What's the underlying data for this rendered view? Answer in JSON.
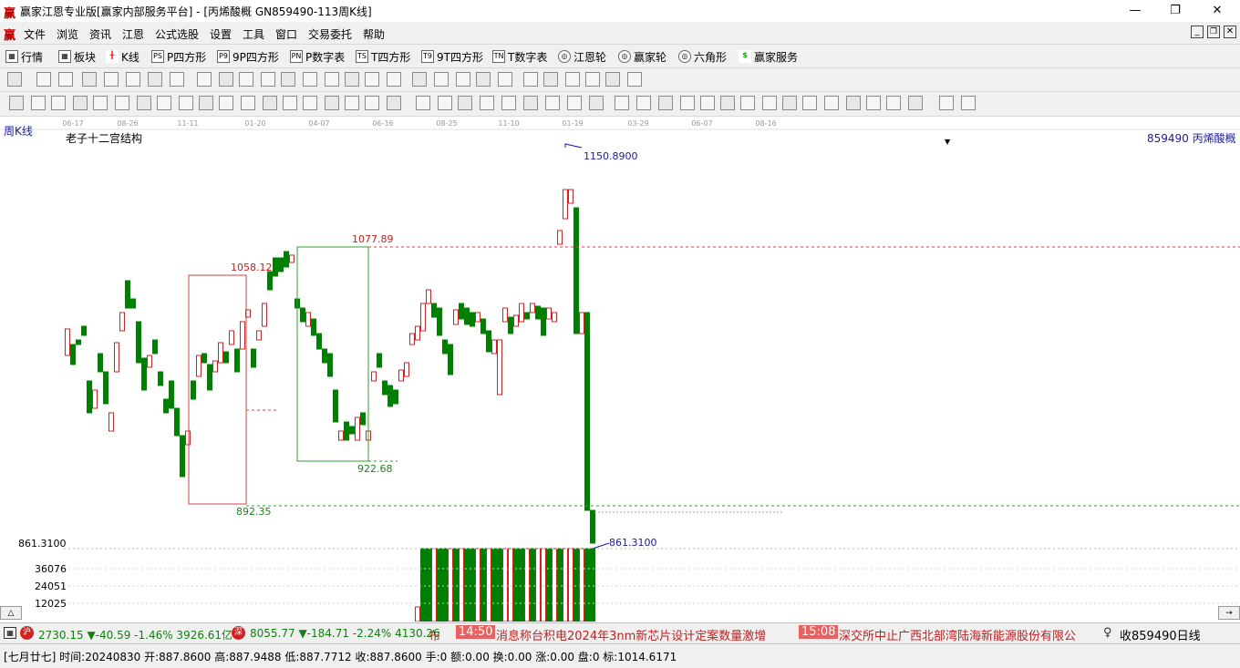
{
  "window": {
    "title": "赢家江恩专业版[赢家内部服务平台] - [丙烯酸概  GN859490-113周K线]"
  },
  "menu": [
    "文件",
    "浏览",
    "资讯",
    "江恩",
    "公式选股",
    "设置",
    "工具",
    "窗口",
    "交易委托",
    "帮助"
  ],
  "toolbar1": [
    "行情",
    "板块",
    "K线",
    "P四方形",
    "9P四方形",
    "P数字表",
    "T四方形",
    "9T四方形",
    "T数字表",
    "江恩轮",
    "赢家轮",
    "六角形",
    "赢家服务"
  ],
  "chart": {
    "period_label": "周K线",
    "indicator_title": "老子十二宫结构",
    "stock_label": "859490  丙烯酸概",
    "date_ticks": [
      "06-17",
      "08-26",
      "11-11",
      "01-20",
      "04-07",
      "06-16",
      "08-25",
      "11-10",
      "01-19",
      "03-29",
      "06-07",
      "08-16"
    ],
    "price_labels": {
      "high": "1150.8900",
      "level_a": "1077.89",
      "level_b": "1058.12",
      "level_c": "922.68",
      "level_d": "892.35",
      "low_right": "861.3100"
    },
    "volume_axis": [
      "861.3100",
      "36076",
      "24051",
      "12025"
    ]
  },
  "ticker": {
    "index1": "2730.15 ▼-40.59 -1.46% 3926.61亿",
    "index2": "8055.77 ▼-184.71 -2.24% 4130.26",
    "news_cut": "布",
    "news1_time": "14:50",
    "news1_text": "消息称台积电2024年3nm新芯片设计定案数量激增",
    "news2_time": "15:08",
    "news2_text": "深交所中止广西北部湾陆海新能源股份有限公",
    "right": "收859490日线"
  },
  "infobar": {
    "text": "[七月廿七] 时间:20240830 开:887.8600 高:887.9488 低:887.7712 收:887.8600 手:0 额:0.00 换:0.00 涨:0.00 盘:0 标:1014.6171"
  },
  "colors": {
    "up": "#d42020",
    "down": "#008000",
    "label_blue": "#1a1aa0"
  },
  "icons": [
    "app-logo-icon",
    "minimize-icon",
    "maximize-icon",
    "close-icon"
  ]
}
